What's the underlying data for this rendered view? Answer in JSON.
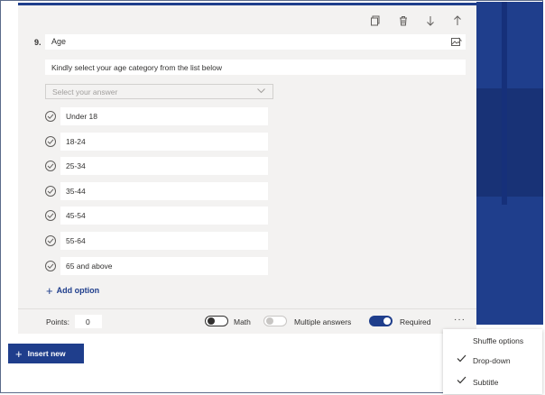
{
  "question": {
    "number": "9.",
    "title": "Age",
    "subtitle": "Kindly select your age category from the list below",
    "placeholder": "Select your answer",
    "options": [
      "Under 18",
      "18-24",
      "25-34",
      "35-44",
      "45-54",
      "55-64",
      "65 and above"
    ],
    "add_option_label": "Add option"
  },
  "footer": {
    "points_label": "Points:",
    "points_value": "0",
    "math_label": "Math",
    "math_on": false,
    "multiple_answers_label": "Multiple answers",
    "multiple_answers_enabled": false,
    "required_label": "Required",
    "required_on": true,
    "more_label": "···"
  },
  "toolbar": {
    "icons": [
      "copy-icon",
      "delete-icon",
      "move-down-icon",
      "move-up-icon"
    ]
  },
  "insert_new_label": "Insert new",
  "menu": {
    "items": [
      {
        "label": "Shuffle options",
        "checked": false
      },
      {
        "label": "Drop-down",
        "checked": true
      },
      {
        "label": "Subtitle",
        "checked": true
      }
    ]
  },
  "colors": {
    "accent": "#1f3e8c",
    "card": "#f3f2f1"
  }
}
